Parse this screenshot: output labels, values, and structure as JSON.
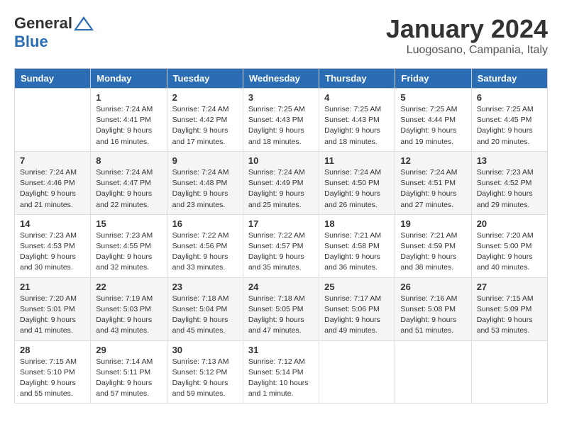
{
  "header": {
    "logo": {
      "general": "General",
      "blue": "Blue"
    },
    "title": "January 2024",
    "location": "Luogosano, Campania, Italy"
  },
  "calendar": {
    "days_of_week": [
      "Sunday",
      "Monday",
      "Tuesday",
      "Wednesday",
      "Thursday",
      "Friday",
      "Saturday"
    ],
    "weeks": [
      [
        {
          "day": "",
          "info": ""
        },
        {
          "day": "1",
          "info": "Sunrise: 7:24 AM\nSunset: 4:41 PM\nDaylight: 9 hours\nand 16 minutes."
        },
        {
          "day": "2",
          "info": "Sunrise: 7:24 AM\nSunset: 4:42 PM\nDaylight: 9 hours\nand 17 minutes."
        },
        {
          "day": "3",
          "info": "Sunrise: 7:25 AM\nSunset: 4:43 PM\nDaylight: 9 hours\nand 18 minutes."
        },
        {
          "day": "4",
          "info": "Sunrise: 7:25 AM\nSunset: 4:43 PM\nDaylight: 9 hours\nand 18 minutes."
        },
        {
          "day": "5",
          "info": "Sunrise: 7:25 AM\nSunset: 4:44 PM\nDaylight: 9 hours\nand 19 minutes."
        },
        {
          "day": "6",
          "info": "Sunrise: 7:25 AM\nSunset: 4:45 PM\nDaylight: 9 hours\nand 20 minutes."
        }
      ],
      [
        {
          "day": "7",
          "info": "Sunrise: 7:24 AM\nSunset: 4:46 PM\nDaylight: 9 hours\nand 21 minutes."
        },
        {
          "day": "8",
          "info": "Sunrise: 7:24 AM\nSunset: 4:47 PM\nDaylight: 9 hours\nand 22 minutes."
        },
        {
          "day": "9",
          "info": "Sunrise: 7:24 AM\nSunset: 4:48 PM\nDaylight: 9 hours\nand 23 minutes."
        },
        {
          "day": "10",
          "info": "Sunrise: 7:24 AM\nSunset: 4:49 PM\nDaylight: 9 hours\nand 25 minutes."
        },
        {
          "day": "11",
          "info": "Sunrise: 7:24 AM\nSunset: 4:50 PM\nDaylight: 9 hours\nand 26 minutes."
        },
        {
          "day": "12",
          "info": "Sunrise: 7:24 AM\nSunset: 4:51 PM\nDaylight: 9 hours\nand 27 minutes."
        },
        {
          "day": "13",
          "info": "Sunrise: 7:23 AM\nSunset: 4:52 PM\nDaylight: 9 hours\nand 29 minutes."
        }
      ],
      [
        {
          "day": "14",
          "info": "Sunrise: 7:23 AM\nSunset: 4:53 PM\nDaylight: 9 hours\nand 30 minutes."
        },
        {
          "day": "15",
          "info": "Sunrise: 7:23 AM\nSunset: 4:55 PM\nDaylight: 9 hours\nand 32 minutes."
        },
        {
          "day": "16",
          "info": "Sunrise: 7:22 AM\nSunset: 4:56 PM\nDaylight: 9 hours\nand 33 minutes."
        },
        {
          "day": "17",
          "info": "Sunrise: 7:22 AM\nSunset: 4:57 PM\nDaylight: 9 hours\nand 35 minutes."
        },
        {
          "day": "18",
          "info": "Sunrise: 7:21 AM\nSunset: 4:58 PM\nDaylight: 9 hours\nand 36 minutes."
        },
        {
          "day": "19",
          "info": "Sunrise: 7:21 AM\nSunset: 4:59 PM\nDaylight: 9 hours\nand 38 minutes."
        },
        {
          "day": "20",
          "info": "Sunrise: 7:20 AM\nSunset: 5:00 PM\nDaylight: 9 hours\nand 40 minutes."
        }
      ],
      [
        {
          "day": "21",
          "info": "Sunrise: 7:20 AM\nSunset: 5:01 PM\nDaylight: 9 hours\nand 41 minutes."
        },
        {
          "day": "22",
          "info": "Sunrise: 7:19 AM\nSunset: 5:03 PM\nDaylight: 9 hours\nand 43 minutes."
        },
        {
          "day": "23",
          "info": "Sunrise: 7:18 AM\nSunset: 5:04 PM\nDaylight: 9 hours\nand 45 minutes."
        },
        {
          "day": "24",
          "info": "Sunrise: 7:18 AM\nSunset: 5:05 PM\nDaylight: 9 hours\nand 47 minutes."
        },
        {
          "day": "25",
          "info": "Sunrise: 7:17 AM\nSunset: 5:06 PM\nDaylight: 9 hours\nand 49 minutes."
        },
        {
          "day": "26",
          "info": "Sunrise: 7:16 AM\nSunset: 5:08 PM\nDaylight: 9 hours\nand 51 minutes."
        },
        {
          "day": "27",
          "info": "Sunrise: 7:15 AM\nSunset: 5:09 PM\nDaylight: 9 hours\nand 53 minutes."
        }
      ],
      [
        {
          "day": "28",
          "info": "Sunrise: 7:15 AM\nSunset: 5:10 PM\nDaylight: 9 hours\nand 55 minutes."
        },
        {
          "day": "29",
          "info": "Sunrise: 7:14 AM\nSunset: 5:11 PM\nDaylight: 9 hours\nand 57 minutes."
        },
        {
          "day": "30",
          "info": "Sunrise: 7:13 AM\nSunset: 5:12 PM\nDaylight: 9 hours\nand 59 minutes."
        },
        {
          "day": "31",
          "info": "Sunrise: 7:12 AM\nSunset: 5:14 PM\nDaylight: 10 hours\nand 1 minute."
        },
        {
          "day": "",
          "info": ""
        },
        {
          "day": "",
          "info": ""
        },
        {
          "day": "",
          "info": ""
        }
      ]
    ]
  }
}
